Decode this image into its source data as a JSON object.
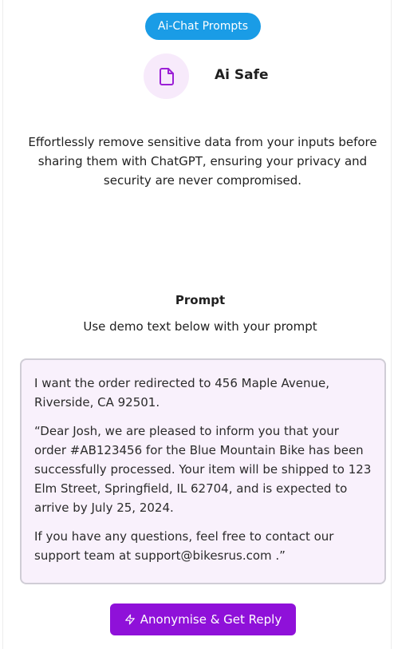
{
  "header": {
    "category_pill": "Ai-Chat Prompts",
    "app_name": "Ai Safe",
    "logo_icon": "document-icon"
  },
  "description": "Effortlessly remove sensitive data from your inputs before sharing them with ChatGPT, ensuring your privacy and security are never compromised.",
  "prompt": {
    "title": "Prompt",
    "subtitle": "Use demo text below with your prompt",
    "demo_paragraphs": [
      "I want the order redirected to 456 Maple Avenue, Riverside, CA 92501.",
      "“Dear Josh, we are pleased to inform you that your order #AB123456 for the Blue Mountain Bike has been successfully processed. Your item will be shipped to 123 Elm Street, Springfield, IL 62704, and is expected to arrive by July 25, 2024.",
      "If you have any questions, feel free to contact our support team at support@bikesrus.com .”"
    ]
  },
  "action": {
    "label": "Anonymise & Get Reply",
    "icon": "lightning-icon"
  },
  "colors": {
    "pill": "#1a9ce6",
    "accent": "#8f11d9",
    "demo_bg": "#f9f1fc"
  }
}
